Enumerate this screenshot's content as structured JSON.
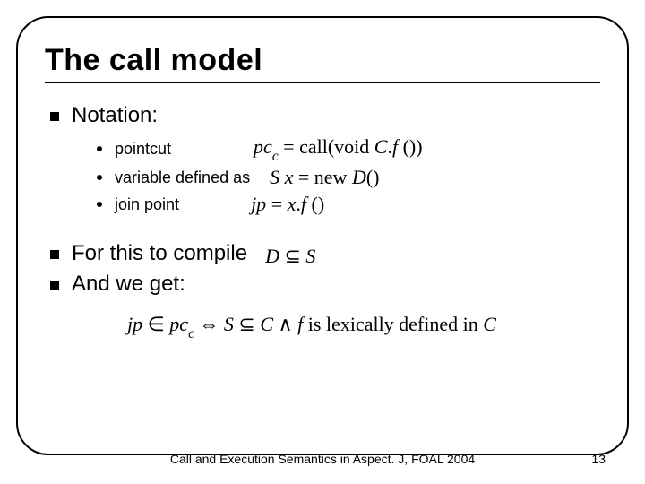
{
  "title": "The call model",
  "bullets": {
    "notation_label": "Notation:",
    "compile_label": "For this to compile",
    "and_we_get_label": "And we get:"
  },
  "sub_items": {
    "pointcut": "pointcut",
    "variable": "variable defined as",
    "joinpoint": "join point"
  },
  "math": {
    "pointcut_lhs_var": "pc",
    "pointcut_lhs_sub": "c",
    "pointcut_rhs_prefix": " = call(void ",
    "pointcut_rhs_class": "C",
    "pointcut_rhs_dot": ".",
    "pointcut_rhs_fn": "f",
    "pointcut_rhs_suffix": " ())",
    "var_lhs_type": "S",
    "var_lhs_name": " x",
    "var_rhs_prefix": " = new ",
    "var_rhs_class": "D",
    "var_rhs_suffix": "()",
    "jp_lhs": "jp",
    "jp_rhs_prefix": " = ",
    "jp_rhs_x": "x",
    "jp_rhs_dot": ".",
    "jp_rhs_fn": "f",
    "jp_rhs_suffix": " ()",
    "compile_lhs": "D",
    "compile_rel": " ⊆ ",
    "compile_rhs": "S",
    "concl_jp": "jp",
    "concl_in": " ∈ ",
    "concl_pc": "pc",
    "concl_pc_sub": "c",
    "concl_iff": " ⇔ ",
    "concl_S": "S",
    "concl_sub": " ⊆ ",
    "concl_C": "C",
    "concl_and": " ∧ ",
    "concl_f": "f",
    "concl_tail": "  is lexically defined in ",
    "concl_C2": "C"
  },
  "footer": "Call and Execution Semantics in Aspect. J, FOAL 2004",
  "page": "13"
}
